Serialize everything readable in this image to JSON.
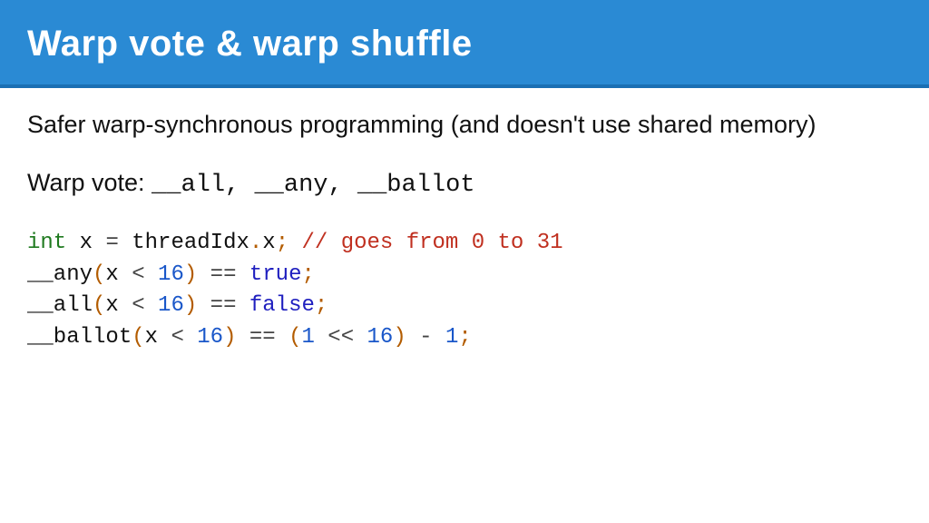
{
  "title": "Warp vote & warp shuffle",
  "intro": "Safer warp-synchronous programming (and doesn't use shared memory)",
  "vote_label": "Warp vote: ",
  "vote_funcs": "__all, __any, __ballot",
  "code": {
    "l1a": "int",
    "l1b": " x ",
    "l1c": "=",
    "l1d": " threadIdx",
    "l1e": ".",
    "l1f": "x",
    "l1g": ";",
    "l1h": " // goes from 0 to 31",
    "l2a": "__any",
    "l2b": "(",
    "l2c": "x ",
    "l2d": "<",
    "l2e": " 16",
    "l2f": ")",
    "l2g": " == ",
    "l2h": "true",
    "l2i": ";",
    "l3a": "__all",
    "l3b": "(",
    "l3c": "x ",
    "l3d": "<",
    "l3e": " 16",
    "l3f": ")",
    "l3g": " == ",
    "l3h": "false",
    "l3i": ";",
    "l4a": "__ballot",
    "l4b": "(",
    "l4c": "x ",
    "l4d": "<",
    "l4e": " 16",
    "l4f": ")",
    "l4g": " == ",
    "l4h": "(",
    "l4i": "1",
    "l4j": " << ",
    "l4k": "16",
    "l4l": ")",
    "l4m": " - ",
    "l4n": "1",
    "l4o": ";"
  }
}
